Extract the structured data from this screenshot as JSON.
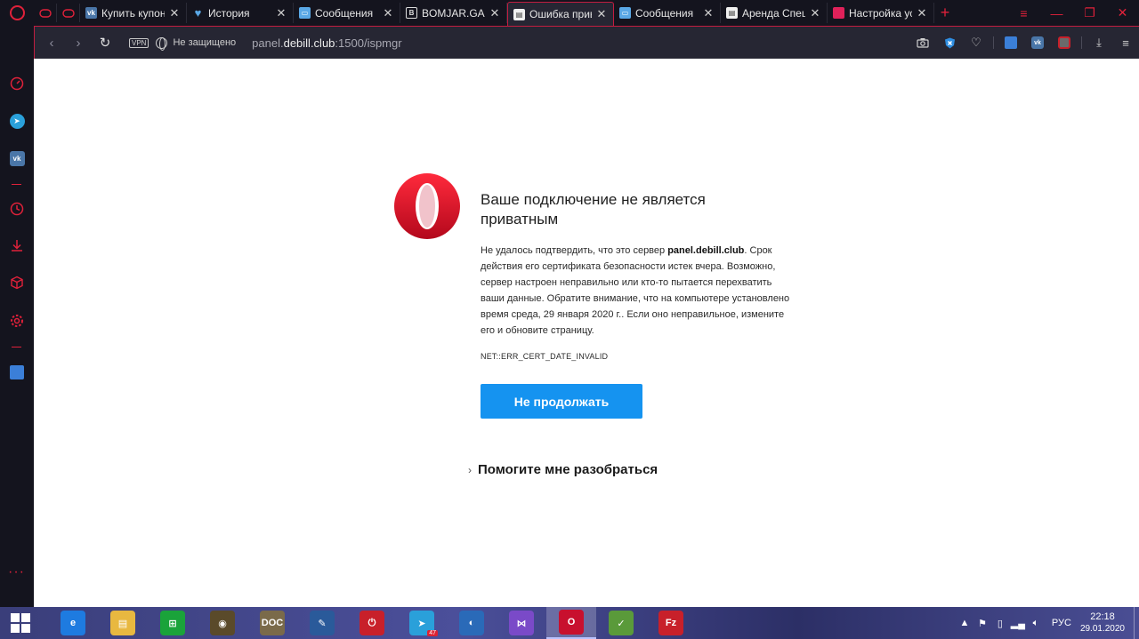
{
  "tabs": {
    "pinned": [
      {
        "icon": "gamepad-icon"
      },
      {
        "icon": "gamepad-icon"
      }
    ],
    "items": [
      {
        "icon": "vk-icon",
        "icon_color": "#4a76a8",
        "label": "Купить купон"
      },
      {
        "icon": "heart-icon",
        "icon_color": "#5aa8e6",
        "label": "История"
      },
      {
        "icon": "messages-icon",
        "icon_color": "#5aa8e6",
        "label": "Сообщения"
      },
      {
        "icon": "bomjar-icon",
        "icon_color": "#ffffff",
        "label": "BOMJAR.GA"
      },
      {
        "icon": "page-icon",
        "icon_color": "#ffffff",
        "label": "Ошибка прив"
      },
      {
        "icon": "messages-icon",
        "icon_color": "#5aa8e6",
        "label": "Сообщения"
      },
      {
        "icon": "page-icon",
        "icon_color": "#ffffff",
        "label": "Аренда Спец"
      },
      {
        "icon": "settings-page-icon",
        "icon_color": "#e0215a",
        "label": "Настройка ус"
      }
    ],
    "close_glyph": "✕",
    "active_index": 4
  },
  "window_controls": {
    "min": "—",
    "restore": "❐",
    "close": "✕"
  },
  "address": {
    "vpn": "VPN",
    "security": "Не защищено",
    "url_host_prefix": "panel.",
    "url_host_main": "debill.club",
    "url_rest": ":1500/ispmgr"
  },
  "page": {
    "title": "Ваше подключение не является приватным",
    "body_before": "Не удалось подтвердить, что это сервер ",
    "body_bold": "panel.debill.club",
    "body_after": ". Срок действия его сертификата безопасности истек вчера. Возможно, сервер настроен неправильно или кто-то пытается перехватить ваши данные. Обратите внимание, что на компьютере установлено время среда, 29 января 2020 г.. Если оно неправильное, измените его и обновите страницу.",
    "error_code": "NET::ERR_CERT_DATE_INVALID",
    "button": "Не продолжать",
    "help": "Помогите мне разобраться"
  },
  "taskbar": {
    "apps": [
      {
        "name": "ie",
        "color": "#1e7be0",
        "glyph": "e"
      },
      {
        "name": "file-explorer",
        "color": "#e8b840",
        "glyph": "▤"
      },
      {
        "name": "store",
        "color": "#1aa33a",
        "glyph": "⊞"
      },
      {
        "name": "speaker-app",
        "color": "#5a4a2a",
        "glyph": "◉"
      },
      {
        "name": "doc-app",
        "color": "#7a6a4a",
        "glyph": "DOC"
      },
      {
        "name": "editor-app",
        "color": "#2a5a9a",
        "glyph": "✎"
      },
      {
        "name": "power-app",
        "color": "#c8202a",
        "glyph": "⏻"
      },
      {
        "name": "telegram",
        "color": "#2aa0da",
        "glyph": "➤",
        "badge": "47"
      },
      {
        "name": "browser-app",
        "color": "#2a6ab8",
        "glyph": "◐"
      },
      {
        "name": "visual-studio",
        "color": "#7a4ac8",
        "glyph": "⋈"
      },
      {
        "name": "opera",
        "color": "#c8102e",
        "glyph": "O"
      },
      {
        "name": "notepad-app",
        "color": "#5a9a3a",
        "glyph": "✓"
      },
      {
        "name": "filezilla",
        "color": "#c8202a",
        "glyph": "Fz"
      }
    ],
    "active_index": 10,
    "lang": "РУС",
    "time": "22:18",
    "date": "29.01.2020"
  }
}
